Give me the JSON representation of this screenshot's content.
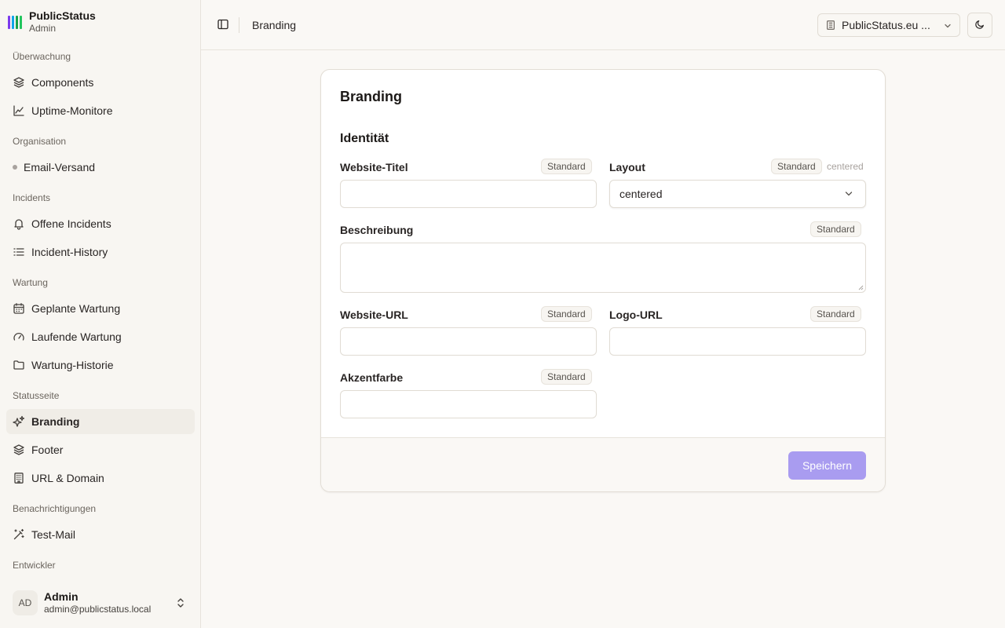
{
  "app": {
    "name": "PublicStatus",
    "role": "Admin",
    "logo_colors": [
      "#7c3aed",
      "#0ea5e9",
      "#16a34a",
      "#22c55e"
    ]
  },
  "sidebar": {
    "sections": [
      {
        "label": "Überwachung"
      },
      {
        "label": "Organisation"
      },
      {
        "label": "Incidents"
      },
      {
        "label": "Wartung"
      },
      {
        "label": "Statusseite"
      },
      {
        "label": "Benachrichtigungen"
      },
      {
        "label": "Entwickler"
      }
    ],
    "items": [
      {
        "label": "Components",
        "icon": "layers-icon"
      },
      {
        "label": "Uptime-Monitore",
        "icon": "line-chart-icon"
      },
      {
        "label": "Email-Versand",
        "icon": "dot-icon"
      },
      {
        "label": "Offene Incidents",
        "icon": "bell-icon"
      },
      {
        "label": "Incident-History",
        "icon": "list-icon"
      },
      {
        "label": "Geplante Wartung",
        "icon": "calendar-icon"
      },
      {
        "label": "Laufende Wartung",
        "icon": "gauge-icon"
      },
      {
        "label": "Wartung-Historie",
        "icon": "folder-icon"
      },
      {
        "label": "Branding",
        "icon": "sparkles-icon",
        "active": true
      },
      {
        "label": "Footer",
        "icon": "layers-icon"
      },
      {
        "label": "URL & Domain",
        "icon": "building-icon"
      },
      {
        "label": "Test-Mail",
        "icon": "wand-icon"
      }
    ],
    "user": {
      "initials": "AD",
      "name": "Admin",
      "email": "admin@publicstatus.local"
    }
  },
  "header": {
    "title": "Branding",
    "site_selector": "PublicStatus.eu ...",
    "theme_icon": "moon-icon"
  },
  "card": {
    "title": "Branding",
    "section": "Identität",
    "default_badge": "Standard",
    "fields": {
      "website_title": {
        "label": "Website-Titel",
        "value": ""
      },
      "layout": {
        "label": "Layout",
        "value": "centered",
        "default_value": "centered"
      },
      "description": {
        "label": "Beschreibung",
        "value": ""
      },
      "website_url": {
        "label": "Website-URL",
        "value": ""
      },
      "logo_url": {
        "label": "Logo-URL",
        "value": ""
      },
      "accent_color": {
        "label": "Akzentfarbe",
        "value": ""
      }
    },
    "save_label": "Speichern",
    "save_color": "#a99cf0"
  }
}
